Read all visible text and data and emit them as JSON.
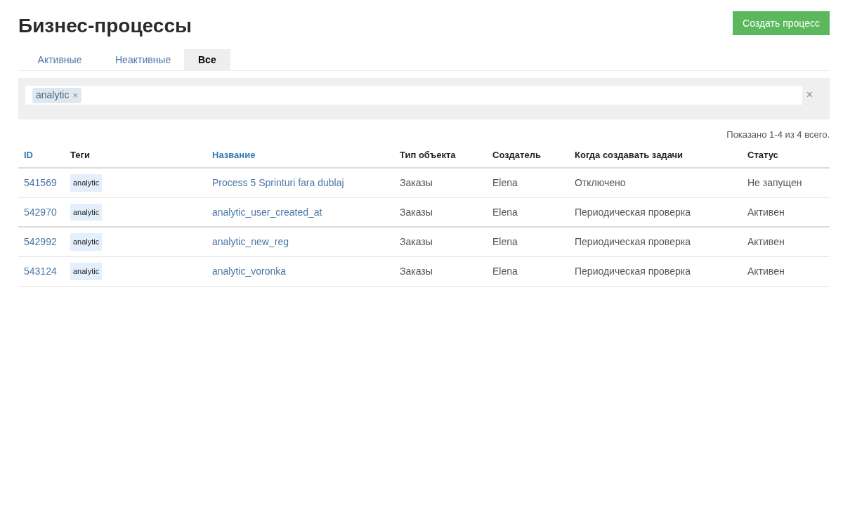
{
  "title": "Бизнес-процессы",
  "create_button": "Создать процесс",
  "tabs": [
    {
      "label": "Активные",
      "selected": false
    },
    {
      "label": "Неактивные",
      "selected": false
    },
    {
      "label": "Все",
      "selected": true
    }
  ],
  "filter": {
    "tags": [
      {
        "label": "analytic",
        "remove": "×"
      }
    ],
    "clear": "×"
  },
  "summary": "Показано 1-4 из 4 всего.",
  "table": {
    "columns": [
      {
        "label": "ID",
        "sortable": true
      },
      {
        "label": "Теги",
        "sortable": false
      },
      {
        "label": "Название",
        "sortable": true
      },
      {
        "label": "Тип объекта",
        "sortable": false
      },
      {
        "label": "Создатель",
        "sortable": false
      },
      {
        "label": "Когда создавать задачи",
        "sortable": false
      },
      {
        "label": "Статус",
        "sortable": false
      }
    ],
    "rows": [
      {
        "id": "541569",
        "tag": "analytic",
        "name": "Process 5 Sprinturi fara dublaj",
        "object_type": "Заказы",
        "creator": "Elena",
        "schedule": "Отключено",
        "status": "Не запущен"
      },
      {
        "id": "542970",
        "tag": "analytic",
        "name": "analytic_user_created_at",
        "object_type": "Заказы",
        "creator": "Elena",
        "schedule": "Периодическая проверка",
        "status": "Активен"
      },
      {
        "id": "542992",
        "tag": "analytic",
        "name": "analytic_new_reg",
        "object_type": "Заказы",
        "creator": "Elena",
        "schedule": "Периодическая проверка",
        "status": "Активен"
      },
      {
        "id": "543124",
        "tag": "analytic",
        "name": "analytic_voronka",
        "object_type": "Заказы",
        "creator": "Elena",
        "schedule": "Периодическая проверка",
        "status": "Активен"
      }
    ]
  }
}
